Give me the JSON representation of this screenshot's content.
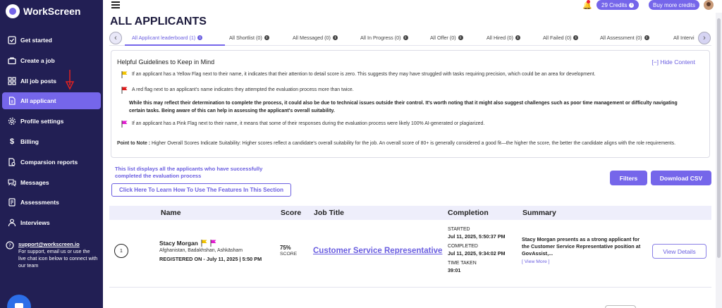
{
  "app": {
    "name": "WorkScreen"
  },
  "colors": {
    "sidebar": "#221f54",
    "accent": "#7566ea",
    "yellow_flag": "#f2c300",
    "red_flag": "#e01a1a",
    "pink_flag": "#e11ccf"
  },
  "sidebar": {
    "items": [
      {
        "label": "Get started",
        "icon": "checklist-icon"
      },
      {
        "label": "Create a job",
        "icon": "briefcase-icon"
      },
      {
        "label": "All job posts",
        "icon": "grid-icon"
      },
      {
        "label": "All applicant",
        "icon": "document-icon",
        "active": true
      },
      {
        "label": "Profile settings",
        "icon": "gear-icon"
      },
      {
        "label": "Billing",
        "icon": "dollar-icon"
      },
      {
        "label": "Comparsion reports",
        "icon": "report-icon"
      },
      {
        "label": "Messages",
        "icon": "message-icon"
      },
      {
        "label": "Assessments",
        "icon": "assessment-icon"
      },
      {
        "label": "Interviews",
        "icon": "person-icon"
      }
    ],
    "support": {
      "email": "support@workscreen.io",
      "text": "For support, email us or use the live chat icon below to connect with our team"
    }
  },
  "header": {
    "credits_label": "29 Credits",
    "buy_label": "Buy more credits"
  },
  "page": {
    "title": "ALL APPLICANTS"
  },
  "tabs": [
    {
      "label": "All Applicant leaderboard (1)",
      "active": true
    },
    {
      "label": "All Shortlist (0)"
    },
    {
      "label": "All Messaged (0)"
    },
    {
      "label": "All In Progress (0)"
    },
    {
      "label": "All Offer (0)"
    },
    {
      "label": "All Hired (0)"
    },
    {
      "label": "All Failed (0)"
    },
    {
      "label": "All Assessment (0)"
    },
    {
      "label": "All Intervi"
    }
  ],
  "guidelines": {
    "title": "Helpful Guidelines to Keep in Mind",
    "hide_label": "[−] Hide Content",
    "yellow": "If an applicant has a Yellow Flag next to their name, it indicates that their attention to detail score is zero. This suggests they may have struggled with tasks requiring precision, which could be an area for development.",
    "red": "A red flag next to an applicant's name indicates they attempted the evaluation process more than twice.",
    "red_note": "While this may reflect their determination to complete the process, it could also be due to technical issues outside their control. It's worth noting that it might also suggest challenges such as poor time management or difficulty navigating certain tasks. Being aware of this can help in assessing the applicant's overall suitability.",
    "pink": "If an applicant has a Pink Flag next to their name, it means that some of their responses during the evaluation process were likely 100% AI-generated or plagiarized.",
    "point_label": "Point to Note :",
    "point_text": "Higher Overall Scores Indicate Suitability: Higher scores reflect a candidate's overall suitability for the job. An overall score of 80+ is generally considered a good fit—the higher the score, the better the candidate aligns with the role requirements."
  },
  "list_info": {
    "description": "This list displays all the applicants who have successfully completed the evaluation process",
    "learn_label": "Click Here To Learn How To Use The Features In This Section",
    "filters_label": "Filters",
    "csv_label": "Download CSV"
  },
  "table": {
    "headers": {
      "name": "Name",
      "score": "Score",
      "job": "Job Title",
      "completion": "Completion",
      "summary": "Summary"
    },
    "rows": [
      {
        "rank": "1",
        "name": "Stacy Morgan",
        "location": "Afghanistan, Badakhshan, Ashkāsham",
        "registered": "REGISTERED ON - July 11, 2025 | 5:50 PM",
        "score": "75%",
        "score_label": "SCORE",
        "job_title": "Customer Service Representative",
        "started_label": "STARTED",
        "started": "Jul 11, 2025, 5:50:37 PM",
        "completed_label": "COMPLETED",
        "completed": "Jul 11, 2025, 9:34:02 PM",
        "time_label": "TIME TAKEN",
        "time": "39:01",
        "summary": "Stacy Morgan presents as a strong applicant for the Customer Service Representative position at GovAssist,...",
        "view_more": "[ View More ]",
        "details_label": "View Details"
      }
    ]
  }
}
